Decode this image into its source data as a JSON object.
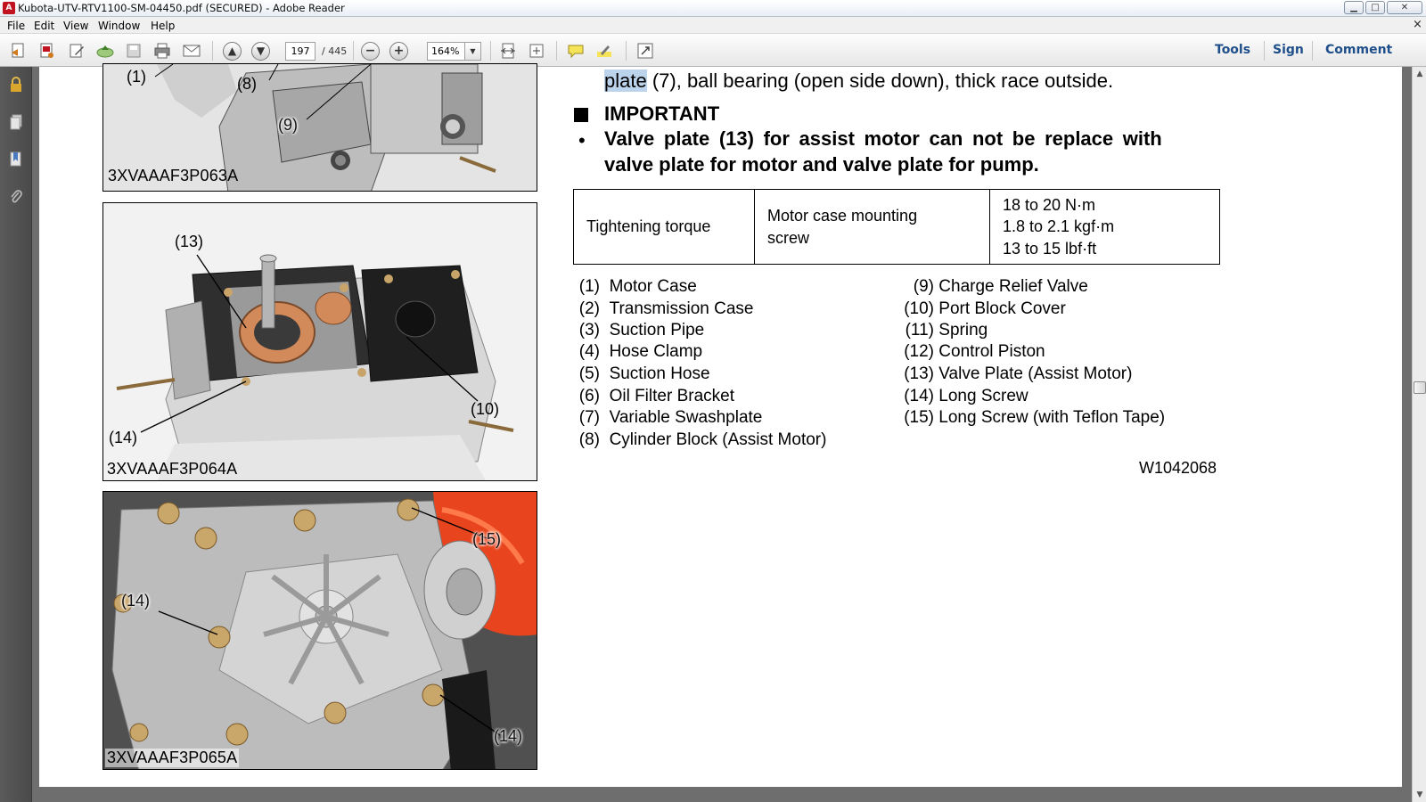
{
  "window": {
    "title": "Kubota-UTV-RTV1100-SM-04450.pdf (SECURED) - Adobe Reader",
    "min_label": "▁",
    "max_label": "□",
    "close_label": "✕"
  },
  "menu": {
    "items": [
      "File",
      "Edit",
      "View",
      "Window",
      "Help"
    ],
    "close_doc": "×"
  },
  "toolbar": {
    "page_current": "197",
    "page_total": "/ 445",
    "zoom": "164%",
    "zoom_dropdown": "▼",
    "zoom_out": "−",
    "zoom_in": "+",
    "panels": [
      "Tools",
      "Sign",
      "Comment"
    ]
  },
  "document": {
    "intro_line": {
      "highlighted": "plate",
      "rest": " (7), ball bearing (open side down), thick race outside."
    },
    "important_heading": "IMPORTANT",
    "bullet": "•",
    "important_line_1": "Valve plate (13) for assist motor can not be replace with",
    "important_line_2": "valve plate for motor and valve plate for pump.",
    "torque_table": {
      "label": "Tightening torque",
      "item_line_1": "Motor case mounting",
      "item_line_2": "screw",
      "values": [
        "18 to 20 N·m",
        "1.8 to 2.1 kgf·m",
        "13 to 15 lbf·ft"
      ]
    },
    "parts_left": [
      {
        "num": "(1)",
        "name": "Motor Case"
      },
      {
        "num": "(2)",
        "name": "Transmission Case"
      },
      {
        "num": "(3)",
        "name": "Suction Pipe"
      },
      {
        "num": "(4)",
        "name": "Hose Clamp"
      },
      {
        "num": "(5)",
        "name": "Suction Hose"
      },
      {
        "num": "(6)",
        "name": "Oil Filter Bracket"
      },
      {
        "num": "(7)",
        "name": "Variable Swashplate"
      },
      {
        "num": "(8)",
        "name": "Cylinder Block (Assist Motor)"
      }
    ],
    "parts_right": [
      {
        "num": "(9)",
        "name": "Charge Relief Valve"
      },
      {
        "num": "(10)",
        "name": "Port Block Cover"
      },
      {
        "num": "(11)",
        "name": "Spring"
      },
      {
        "num": "(12)",
        "name": "Control Piston"
      },
      {
        "num": "(13)",
        "name": "Valve Plate (Assist Motor)"
      },
      {
        "num": "(14)",
        "name": "Long Screw"
      },
      {
        "num": "(15)",
        "name": "Long Screw (with Teflon Tape)"
      }
    ],
    "doc_code": "W1042068",
    "figures": {
      "fig1": {
        "id": "3XVAAAF3P063A",
        "refs": [
          "(1)",
          "(8)",
          "(9)"
        ]
      },
      "fig2": {
        "id": "3XVAAAF3P064A",
        "refs": [
          "(13)",
          "(14)",
          "(10)"
        ]
      },
      "fig3": {
        "id": "3XVAAAF3P065A",
        "refs": [
          "(15)",
          "(14)",
          "(14)"
        ]
      }
    }
  },
  "colors": {
    "panel_link": "#1f4f8a",
    "nav_pane": "#4a4a4a",
    "doc_background": "#6e6e6e",
    "highlight": "#bcd3ec",
    "filter_orange": "#e8451e"
  }
}
